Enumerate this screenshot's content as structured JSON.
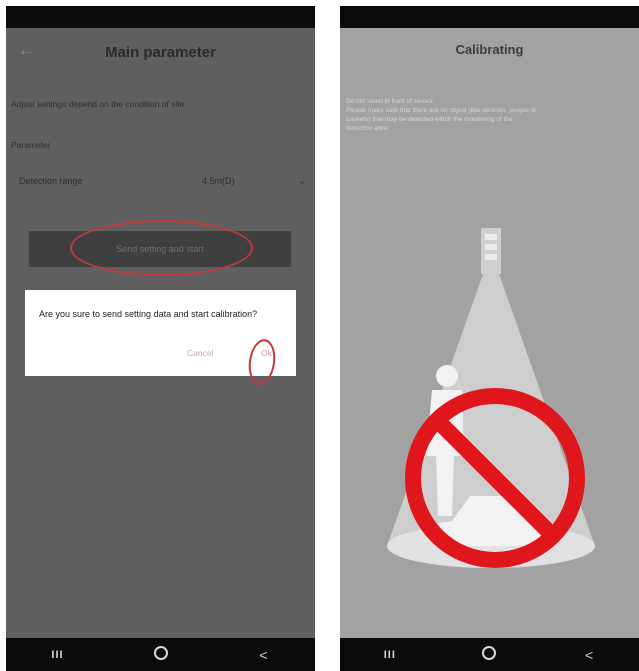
{
  "left_screen": {
    "title": "Main parameter",
    "back_icon": "arrow-left-icon",
    "intro_text": "Adjust settings depend on the condition of site.",
    "param_label": "Parameter",
    "detection_label": "Detection range",
    "detection_value": "4.5m(D)",
    "send_button_label": "Send setting and start",
    "dialog": {
      "message": "Are you sure to send setting data and start calibration?",
      "cancel_label": "Cancel",
      "ok_label": "Ok"
    },
    "annotation_color": "#c23a3a"
  },
  "right_screen": {
    "title": "Calibrating",
    "instruction_lines": [
      "Do not stand in front of sensor.",
      "Please make sure that there are no object (like vehicles, people or",
      "baskets) that may be detected within the monitoring of the",
      "detection area."
    ],
    "prohibition_color": "#e0161d"
  },
  "nav_bar": {
    "recents_glyph": "III",
    "back_glyph": "<"
  }
}
